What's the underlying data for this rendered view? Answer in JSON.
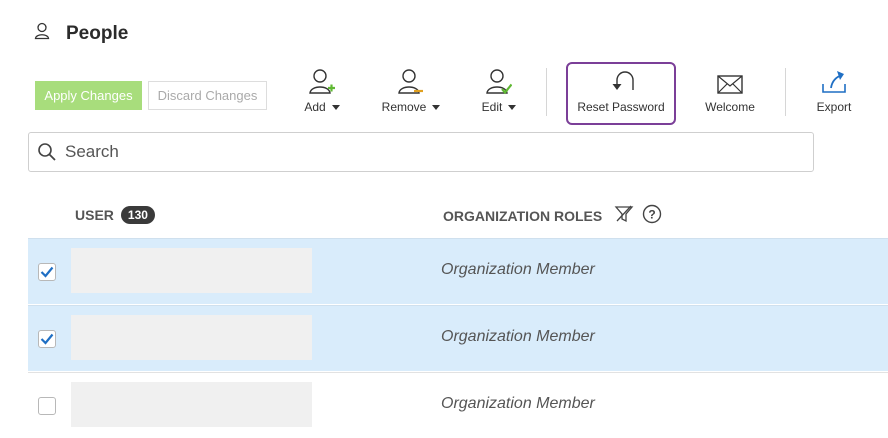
{
  "page": {
    "title": "People",
    "icon": "person-icon"
  },
  "actions": {
    "apply_label": "Apply Changes",
    "discard_label": "Discard Changes"
  },
  "toolbar": {
    "add_label": "Add",
    "remove_label": "Remove",
    "edit_label": "Edit",
    "reset_password_label": "Reset Password",
    "welcome_label": "Welcome",
    "export_label": "Export"
  },
  "search": {
    "placeholder": "Search"
  },
  "table": {
    "user_header": "USER",
    "user_count": "130",
    "roles_header": "ORGANIZATION ROLES",
    "rows": [
      {
        "role": "Organization Member",
        "checked": true
      },
      {
        "role": "Organization Member",
        "checked": true
      },
      {
        "role": "Organization Member",
        "checked": false
      }
    ]
  },
  "colors": {
    "accent": "#7b3f98",
    "apply_green": "#a8dd7c",
    "selected_row": "#d9ecfb",
    "check_blue": "#1f6fc4"
  }
}
